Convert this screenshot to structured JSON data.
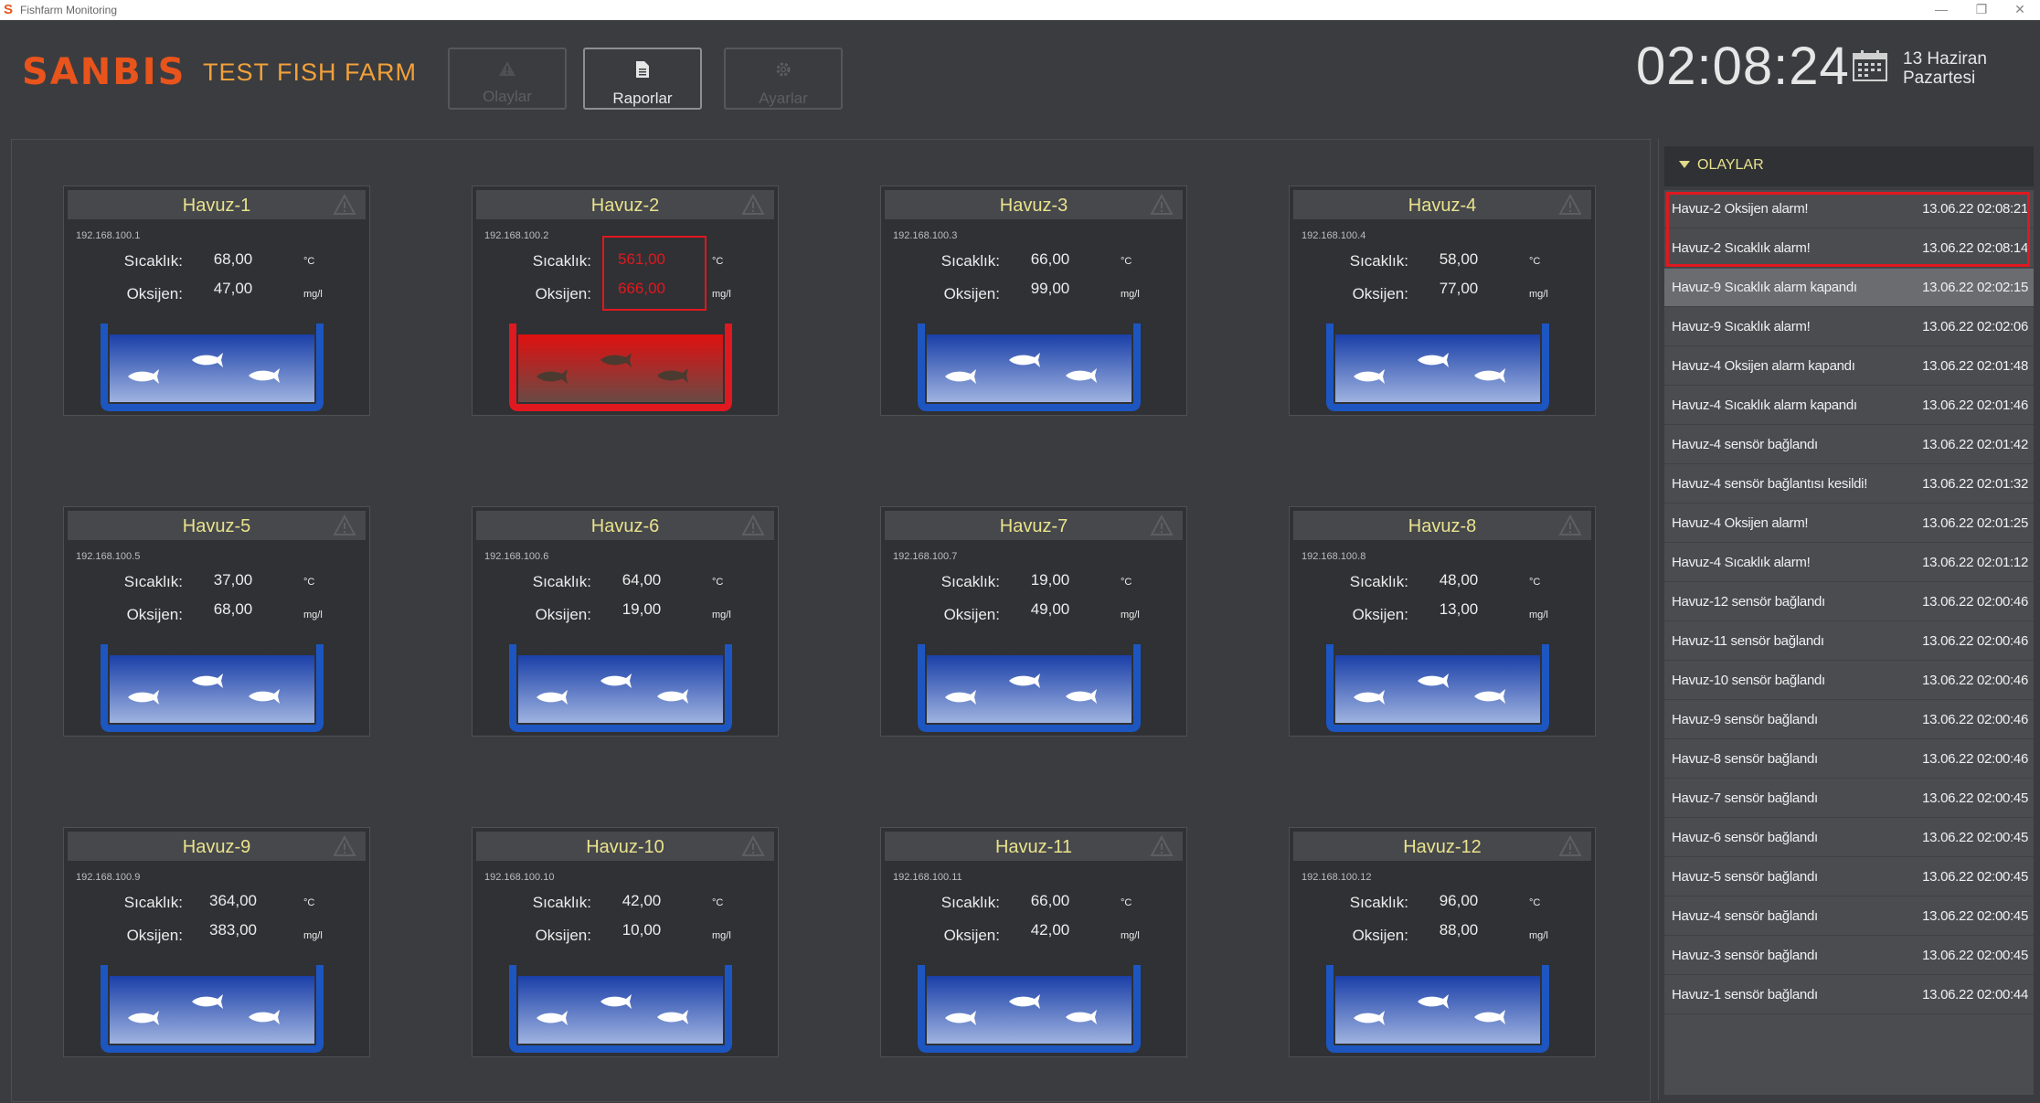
{
  "window": {
    "title": "Fishfarm Monitoring",
    "logo_letter": "S",
    "min_label": "—",
    "restore_label": "❐",
    "close_label": "✕"
  },
  "header": {
    "brand": "SANBIS",
    "farm_name": "TEST FISH FARM",
    "buttons": [
      {
        "label": "Olaylar",
        "icon": "warning-icon",
        "state": "disabled"
      },
      {
        "label": "Raporlar",
        "icon": "document-icon",
        "state": "active"
      },
      {
        "label": "Ayarlar",
        "icon": "gear-icon",
        "state": "disabled"
      }
    ],
    "clock": "02:08:24",
    "date_line1": "13 Haziran",
    "date_line2": "Pazartesi"
  },
  "labels": {
    "temp": "Sıcaklık:",
    "oxy": "Oksijen:",
    "temp_unit": "°C",
    "oxy_unit": "mg/l"
  },
  "colors": {
    "accent": "#e8541b",
    "farm": "#f2a13a",
    "pool_title": "#e9e28c",
    "alarm": "#e0181f",
    "water_top": "#1a3fa8",
    "water_bottom": "#9fb3e0",
    "tank_wall": "#1d56c0",
    "alarm_top": "#e01010",
    "alarm_bottom": "#6a4a44"
  },
  "pools": [
    {
      "name": "Havuz-1",
      "ip": "192.168.100.1",
      "temp": "68,00",
      "oxy": "47,00",
      "alarm": false
    },
    {
      "name": "Havuz-2",
      "ip": "192.168.100.2",
      "temp": "561,00",
      "oxy": "666,00",
      "alarm": true
    },
    {
      "name": "Havuz-3",
      "ip": "192.168.100.3",
      "temp": "66,00",
      "oxy": "99,00",
      "alarm": false
    },
    {
      "name": "Havuz-4",
      "ip": "192.168.100.4",
      "temp": "58,00",
      "oxy": "77,00",
      "alarm": false
    },
    {
      "name": "Havuz-5",
      "ip": "192.168.100.5",
      "temp": "37,00",
      "oxy": "68,00",
      "alarm": false
    },
    {
      "name": "Havuz-6",
      "ip": "192.168.100.6",
      "temp": "64,00",
      "oxy": "19,00",
      "alarm": false
    },
    {
      "name": "Havuz-7",
      "ip": "192.168.100.7",
      "temp": "19,00",
      "oxy": "49,00",
      "alarm": false
    },
    {
      "name": "Havuz-8",
      "ip": "192.168.100.8",
      "temp": "48,00",
      "oxy": "13,00",
      "alarm": false
    },
    {
      "name": "Havuz-9",
      "ip": "192.168.100.9",
      "temp": "364,00",
      "oxy": "383,00",
      "alarm": false
    },
    {
      "name": "Havuz-10",
      "ip": "192.168.100.10",
      "temp": "42,00",
      "oxy": "10,00",
      "alarm": false
    },
    {
      "name": "Havuz-11",
      "ip": "192.168.100.11",
      "temp": "66,00",
      "oxy": "42,00",
      "alarm": false
    },
    {
      "name": "Havuz-12",
      "ip": "192.168.100.12",
      "temp": "96,00",
      "oxy": "88,00",
      "alarm": false
    }
  ],
  "events": {
    "title": "OLAYLAR",
    "items": [
      {
        "text": "Havuz-2 Oksijen alarm!",
        "date": "13.06.22 02:08:21",
        "alarm": true
      },
      {
        "text": "Havuz-2 Sıcaklık alarm!",
        "date": "13.06.22 02:08:14",
        "alarm": true
      },
      {
        "text": "Havuz-9 Sıcaklık alarm kapandı",
        "date": "13.06.22 02:02:15",
        "selected": true
      },
      {
        "text": "Havuz-9 Sıcaklık alarm!",
        "date": "13.06.22 02:02:06"
      },
      {
        "text": "Havuz-4 Oksijen alarm kapandı",
        "date": "13.06.22 02:01:48"
      },
      {
        "text": "Havuz-4 Sıcaklık alarm kapandı",
        "date": "13.06.22 02:01:46"
      },
      {
        "text": "Havuz-4 sensör bağlandı",
        "date": "13.06.22 02:01:42"
      },
      {
        "text": "Havuz-4 sensör bağlantısı kesildi!",
        "date": "13.06.22 02:01:32"
      },
      {
        "text": "Havuz-4 Oksijen alarm!",
        "date": "13.06.22 02:01:25"
      },
      {
        "text": "Havuz-4 Sıcaklık alarm!",
        "date": "13.06.22 02:01:12"
      },
      {
        "text": "Havuz-12 sensör bağlandı",
        "date": "13.06.22 02:00:46"
      },
      {
        "text": "Havuz-11 sensör bağlandı",
        "date": "13.06.22 02:00:46"
      },
      {
        "text": "Havuz-10 sensör bağlandı",
        "date": "13.06.22 02:00:46"
      },
      {
        "text": "Havuz-9 sensör bağlandı",
        "date": "13.06.22 02:00:46"
      },
      {
        "text": "Havuz-8 sensör bağlandı",
        "date": "13.06.22 02:00:46"
      },
      {
        "text": "Havuz-7 sensör bağlandı",
        "date": "13.06.22 02:00:45"
      },
      {
        "text": "Havuz-6 sensör bağlandı",
        "date": "13.06.22 02:00:45"
      },
      {
        "text": "Havuz-5 sensör bağlandı",
        "date": "13.06.22 02:00:45"
      },
      {
        "text": "Havuz-4 sensör bağlandı",
        "date": "13.06.22 02:00:45"
      },
      {
        "text": "Havuz-3 sensör bağlandı",
        "date": "13.06.22 02:00:45"
      },
      {
        "text": "Havuz-1 sensör bağlandı",
        "date": "13.06.22 02:00:44"
      }
    ]
  }
}
